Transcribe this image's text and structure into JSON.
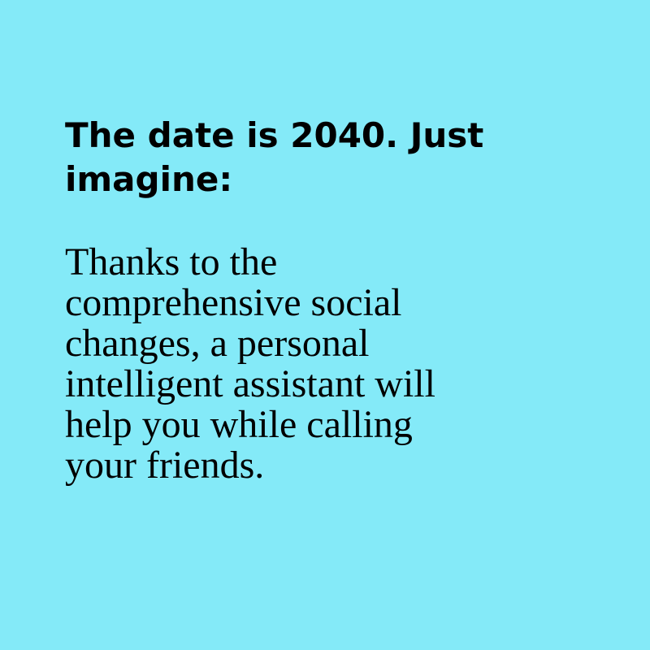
{
  "colors": {
    "background": "#84eaf8",
    "text": "#000000"
  },
  "headline": {
    "lines": [
      "The date is 2040. Just",
      "imagine:"
    ]
  },
  "body": {
    "lines": [
      "Thanks to the",
      "comprehensive social",
      "changes, a personal",
      "intelligent assistant will",
      "help you while calling",
      "your friends."
    ]
  }
}
